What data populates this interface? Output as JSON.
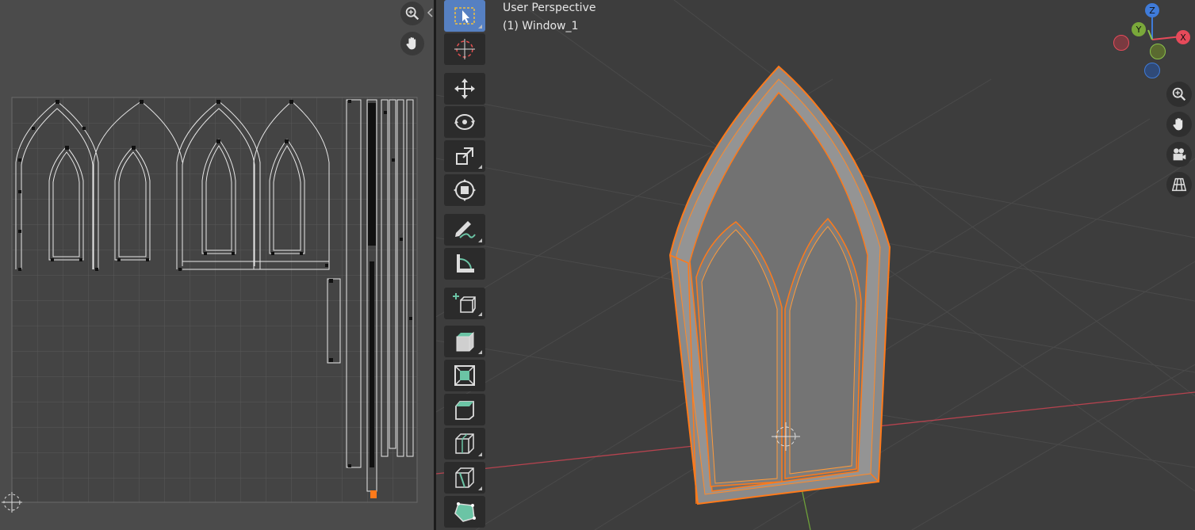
{
  "uv_editor": {
    "zoom_icon": "zoom-in-icon",
    "pan_icon": "hand-pan-icon",
    "cursor_icon": "2d-cursor-icon"
  },
  "viewport": {
    "view_name": "User Perspective",
    "object_name": "(1) Window_1",
    "gizmo": {
      "z_label": "Z",
      "y_label": "Y",
      "x_label": "X"
    },
    "colors": {
      "x_axis": "#e64a5a",
      "y_axis": "#8bc34a",
      "z_axis": "#3f7bd9",
      "selection_outline": "#ff7a1a",
      "active_tool": "#5680c2"
    }
  },
  "toolbar": {
    "tools": [
      {
        "name": "select-box",
        "icon": "select-cursor-icon",
        "active": true
      },
      {
        "name": "cursor",
        "icon": "3d-cursor-icon"
      },
      {
        "name": "move",
        "icon": "move-icon"
      },
      {
        "name": "rotate",
        "icon": "rotate-icon"
      },
      {
        "name": "scale",
        "icon": "scale-icon"
      },
      {
        "name": "transform",
        "icon": "transform-icon"
      },
      {
        "name": "annotate",
        "icon": "annotate-pencil-icon"
      },
      {
        "name": "measure",
        "icon": "measure-ruler-icon"
      },
      {
        "name": "add-cube",
        "icon": "add-cube-icon"
      },
      {
        "name": "extrude",
        "icon": "extrude-icon"
      },
      {
        "name": "inset",
        "icon": "inset-faces-icon"
      },
      {
        "name": "bevel",
        "icon": "bevel-icon"
      },
      {
        "name": "loop-cut",
        "icon": "loop-cut-icon"
      },
      {
        "name": "knife",
        "icon": "knife-icon"
      },
      {
        "name": "poly-build",
        "icon": "poly-build-icon"
      }
    ]
  }
}
